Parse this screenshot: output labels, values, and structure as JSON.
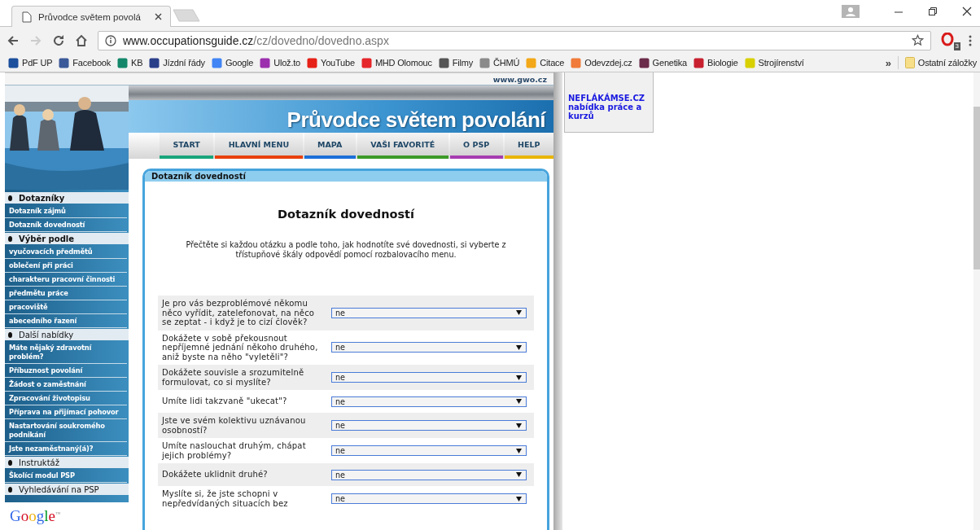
{
  "browser": {
    "tab": {
      "title": "Průvodce světem povolá"
    },
    "back_enabled": true,
    "forward_enabled": false,
    "url": {
      "host": "www.occupationsguide.cz",
      "path": "/cz/dovedno/dovedno.aspx"
    },
    "extension_badge": "3",
    "bookmarks": [
      {
        "label": "PdF UP",
        "color": "#1c4f9c"
      },
      {
        "label": "Facebook",
        "color": "#3b5998"
      },
      {
        "label": "KB",
        "color": "#14876a"
      },
      {
        "label": "Jízdní řády",
        "color": "#2a3f8a"
      },
      {
        "label": "Google",
        "color": "#4285f4"
      },
      {
        "label": "Ulož.to",
        "color": "#9b2fae"
      },
      {
        "label": "YouTube",
        "color": "#e62117"
      },
      {
        "label": "MHD Olomouc",
        "color": "#e5262a"
      },
      {
        "label": "Filmy",
        "color": "#555555"
      },
      {
        "label": "ČHMÚ",
        "color": "#8a8a8a"
      },
      {
        "label": "Citace",
        "color": "#f2a818"
      },
      {
        "label": "Odevzdej.cz",
        "color": "#f07b3a"
      },
      {
        "label": "Genetika",
        "color": "#6b2b4a"
      },
      {
        "label": "Biologie",
        "color": "#c8202f"
      },
      {
        "label": "Strojírenství",
        "color": "#d8d000"
      }
    ],
    "overflow": "»",
    "other_bookmarks": "Ostatní záložky"
  },
  "site": {
    "domain": "www.gwo.cz",
    "title": "Průvodce světem povolání",
    "nav": [
      {
        "label": "START",
        "color": "#19a57c"
      },
      {
        "label": "HLAVNÍ MENU",
        "color": "#e8400c"
      },
      {
        "label": "MAPA",
        "color": "#1c6fd8"
      },
      {
        "label": "VAŠI FAVORITÉ",
        "color": "#3c9a28"
      },
      {
        "label": "O PSP",
        "color": "#a63cb0"
      },
      {
        "label": "HELP",
        "color": "#e8b500"
      }
    ],
    "sidebar": [
      {
        "kind": "header",
        "label": "Dotazníky",
        "bold": true
      },
      {
        "kind": "link",
        "label": "Dotazník zájmů"
      },
      {
        "kind": "link",
        "label": "Dotazník dovedností"
      },
      {
        "kind": "header",
        "label": "Výběr podle",
        "bold": true
      },
      {
        "kind": "link",
        "label": "vyučovacích předmětů"
      },
      {
        "kind": "link",
        "label": "oblečení při práci"
      },
      {
        "kind": "link",
        "label": "charakteru pracovní činnosti"
      },
      {
        "kind": "link",
        "label": "předmětu práce"
      },
      {
        "kind": "link",
        "label": "pracoviště"
      },
      {
        "kind": "link",
        "label": "abecedního řazení"
      },
      {
        "kind": "header",
        "label": "Další nabídky",
        "bold": false
      },
      {
        "kind": "link",
        "label": "Máte nějaký zdravotní problém?"
      },
      {
        "kind": "link",
        "label": "Příbuznost povolání"
      },
      {
        "kind": "link",
        "label": "Žádost o zaměstnání"
      },
      {
        "kind": "link",
        "label": "Zpracování životopisu"
      },
      {
        "kind": "link",
        "label": "Příprava na přijímací pohovor"
      },
      {
        "kind": "link",
        "label": "Nastartování soukromého podnikání"
      },
      {
        "kind": "link",
        "label": "Jste nezaměstnaný(á)?"
      },
      {
        "kind": "header",
        "label": "Instruktáž",
        "bold": false
      },
      {
        "kind": "link",
        "label": "Školící modul PSP"
      },
      {
        "kind": "header",
        "label": "Vyhledávání na PSP",
        "bold": false
      }
    ],
    "search_logo": {
      "text": "Google",
      "mark": "™"
    },
    "panel": {
      "heading": "Dotazník dovedností",
      "title": "Dotazník dovedností",
      "intro": "Přečtěte si každou otázku a podle toho, jak hodnotíte své dovednosti, si vyberte z třístupňové škály odpovědí pomocí rozbalovacího menu.",
      "questions": [
        {
          "text": "Je pro vás bezproblémové někomu něco vyřídit, zatelefonovat, na něco se zeptat - i když je to cizí člověk?",
          "answer": "ne"
        },
        {
          "text": "Dokážete v sobě překousnout nepříjemné jednání někoho druhého, aniž byste na něho \"vyletěli\"?",
          "answer": "ne"
        },
        {
          "text": "Dokážete souvisle a srozumitelně formulovat, co si myslíte?",
          "answer": "ne"
        },
        {
          "text": "Umíte lidi takzvaně \"ukecat\"?",
          "answer": "ne"
        },
        {
          "text": "Jste ve svém kolektivu uznávanou osobností?",
          "answer": "ne"
        },
        {
          "text": "Umíte naslouchat druhým, chápat jejich problémy?",
          "answer": "ne"
        },
        {
          "text": "Dokážete uklidnit druhé?",
          "answer": "ne"
        },
        {
          "text": "Myslíte si, že jste schopni v nepředvídaných situacích bez",
          "answer": "ne"
        }
      ]
    }
  },
  "ad": {
    "text": "NEFLÁKÁMSE.CZ nabídka práce a kurzů"
  }
}
